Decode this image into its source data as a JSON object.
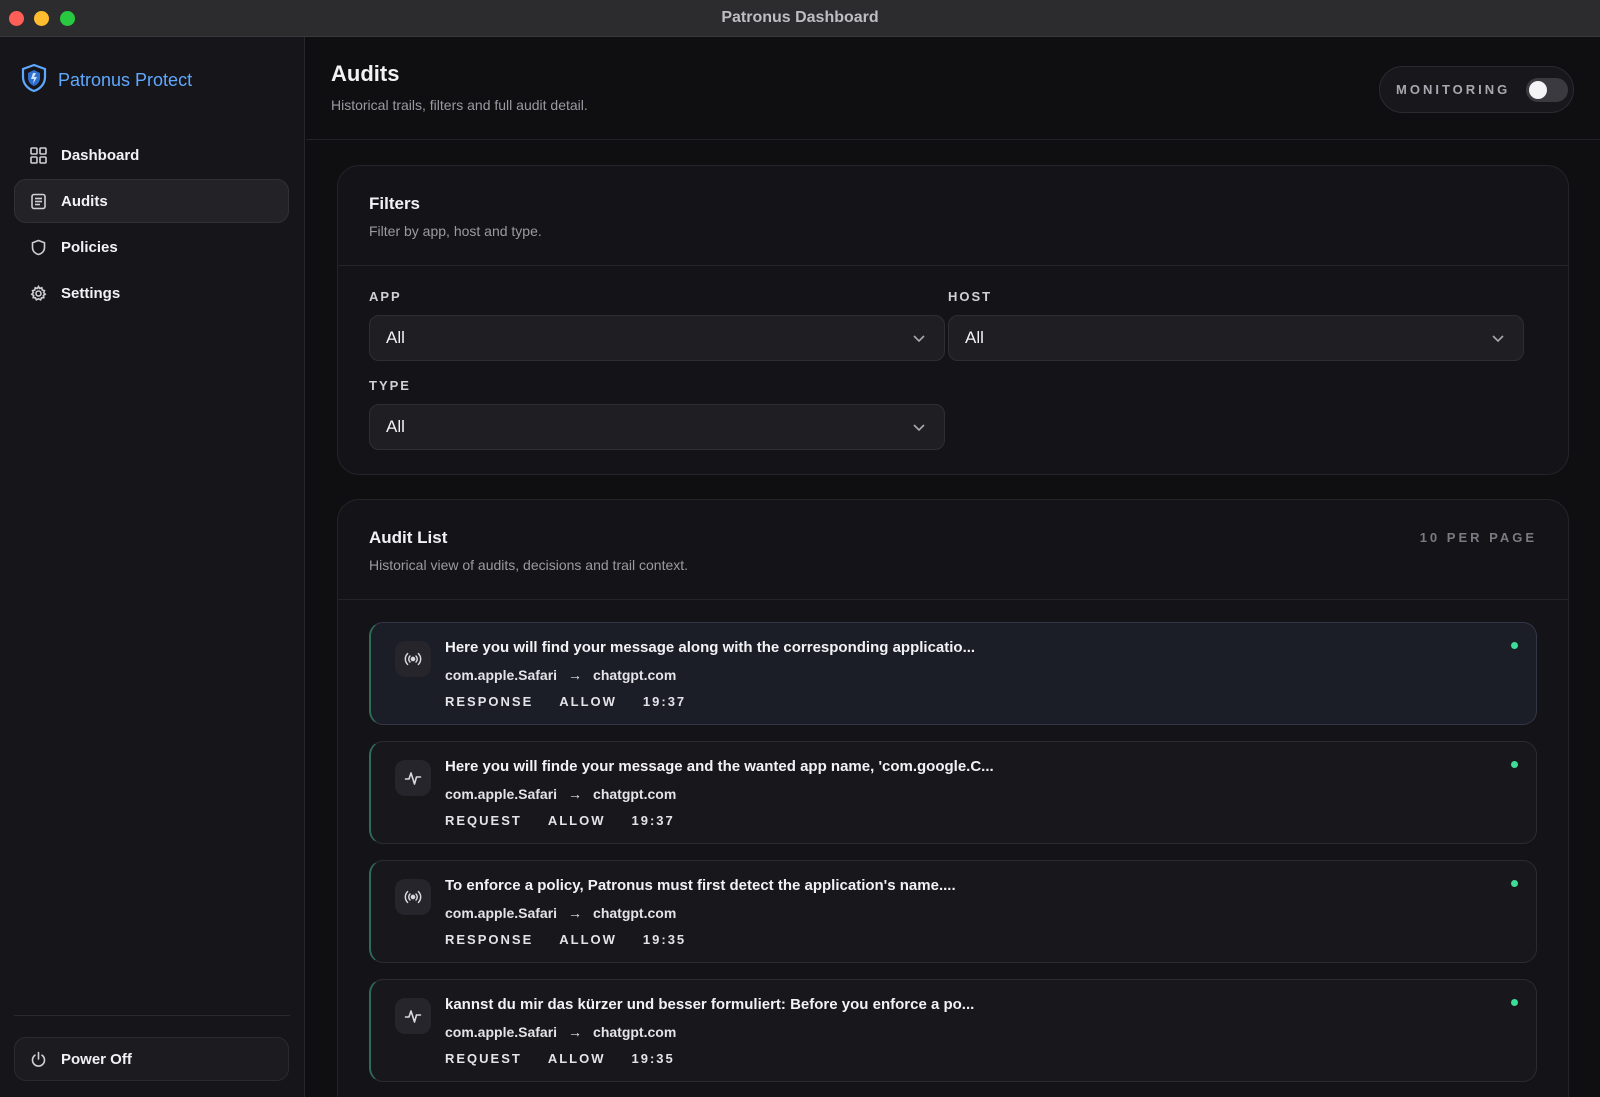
{
  "window": {
    "title": "Patronus Dashboard"
  },
  "sidebar": {
    "brand": "Patronus Protect",
    "items": [
      {
        "label": "Dashboard",
        "icon": "grid-icon",
        "active": false
      },
      {
        "label": "Audits",
        "icon": "list-icon",
        "active": true
      },
      {
        "label": "Policies",
        "icon": "shield-icon",
        "active": false
      },
      {
        "label": "Settings",
        "icon": "gear-icon",
        "active": false
      }
    ],
    "power_label": "Power Off"
  },
  "header": {
    "title": "Audits",
    "subtitle": "Historical trails, filters and full audit detail.",
    "monitoring_label": "MONITORING",
    "monitoring_on": false
  },
  "filters": {
    "title": "Filters",
    "subtitle": "Filter by app, host and type.",
    "app_label": "APP",
    "app_value": "All",
    "host_label": "HOST",
    "host_value": "All",
    "type_label": "TYPE",
    "type_value": "All"
  },
  "audit_list": {
    "title": "Audit List",
    "subtitle": "Historical view of audits, decisions and trail context.",
    "per_page": "10 PER PAGE",
    "arrow": "→",
    "items": [
      {
        "message": "Here you will find your message along with the corresponding applicatio...",
        "app": "com.apple.Safari",
        "host": "chatgpt.com",
        "kind": "RESPONSE",
        "decision": "ALLOW",
        "time": "19:37",
        "icon": "broadcast-icon"
      },
      {
        "message": "Here you will finde your message and the wanted app name, 'com.google.C...",
        "app": "com.apple.Safari",
        "host": "chatgpt.com",
        "kind": "REQUEST",
        "decision": "ALLOW",
        "time": "19:37",
        "icon": "pulse-icon"
      },
      {
        "message": "To enforce a policy, Patronus must first detect the application's name....",
        "app": "com.apple.Safari",
        "host": "chatgpt.com",
        "kind": "RESPONSE",
        "decision": "ALLOW",
        "time": "19:35",
        "icon": "broadcast-icon"
      },
      {
        "message": "kannst du mir das kürzer und besser formuliert: Before you enforce a po...",
        "app": "com.apple.Safari",
        "host": "chatgpt.com",
        "kind": "REQUEST",
        "decision": "ALLOW",
        "time": "19:35",
        "icon": "pulse-icon"
      }
    ]
  },
  "colors": {
    "accent": "#5fa8ff",
    "status_dot": "#3ddc97"
  }
}
